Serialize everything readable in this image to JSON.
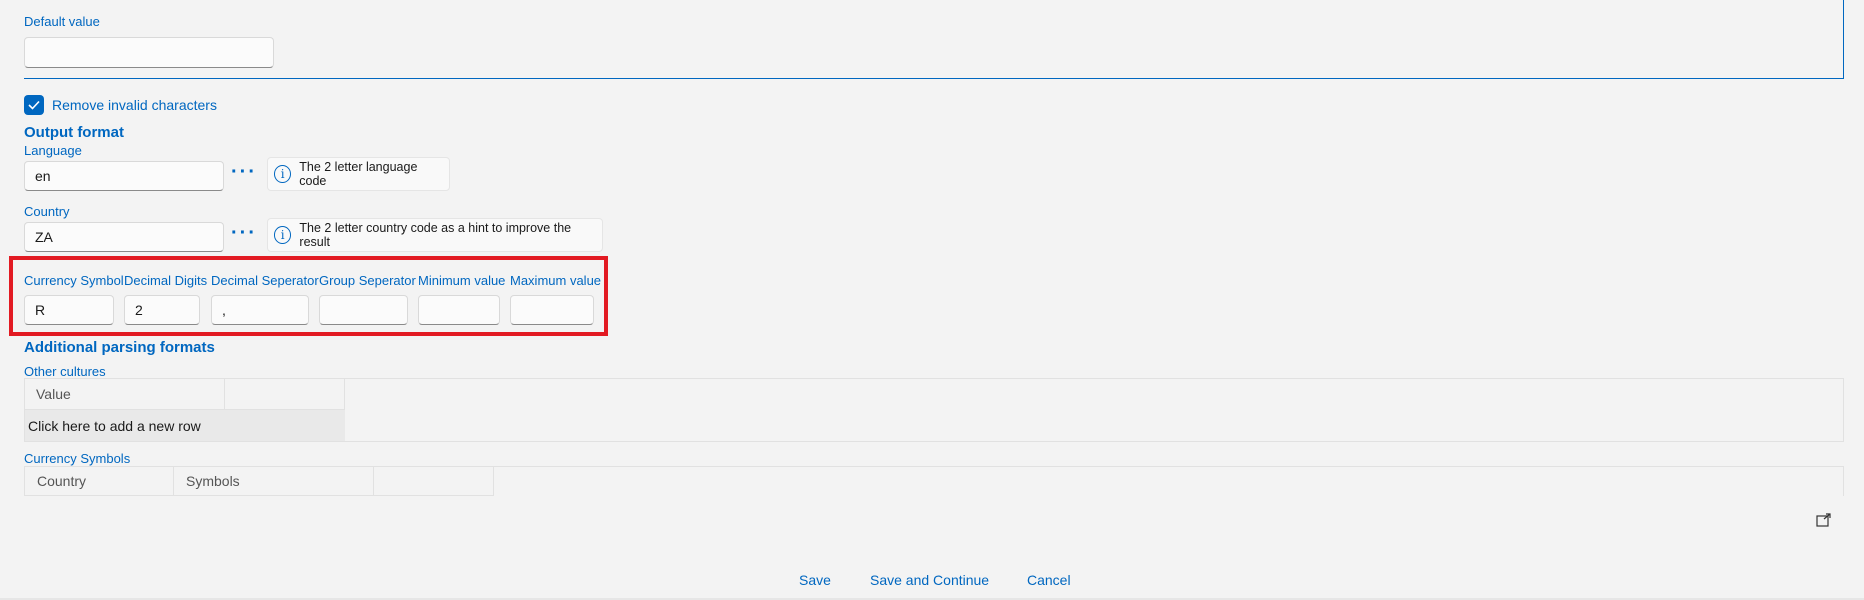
{
  "default_value": {
    "label": "Default value",
    "value": ""
  },
  "remove_invalid": {
    "label": "Remove invalid characters",
    "checked": true
  },
  "output_format": {
    "heading": "Output format",
    "language": {
      "label": "Language",
      "value": "en",
      "info": "The 2 letter language code"
    },
    "country": {
      "label": "Country",
      "value": "ZA",
      "info": "The 2 letter country code as a hint to improve the result"
    },
    "number_fields": [
      {
        "label": "Currency Symbol",
        "value": "R"
      },
      {
        "label": "Decimal Digits",
        "value": "2"
      },
      {
        "label": "Decimal Seperator",
        "value": ","
      },
      {
        "label": "Group Seperator",
        "value": ""
      },
      {
        "label": "Minimum value",
        "value": ""
      },
      {
        "label": "Maximum value",
        "value": ""
      }
    ]
  },
  "additional": {
    "heading": "Additional parsing formats",
    "other_cultures": {
      "label": "Other cultures",
      "column": "Value",
      "add_row": "Click here to add a new row"
    },
    "currency_symbols": {
      "label": "Currency Symbols",
      "columns": [
        "Country",
        "Symbols"
      ]
    }
  },
  "footer": {
    "save": "Save",
    "save_continue": "Save and Continue",
    "cancel": "Cancel"
  },
  "colors": {
    "accent": "#0067c0",
    "highlight": "#e21a22"
  }
}
